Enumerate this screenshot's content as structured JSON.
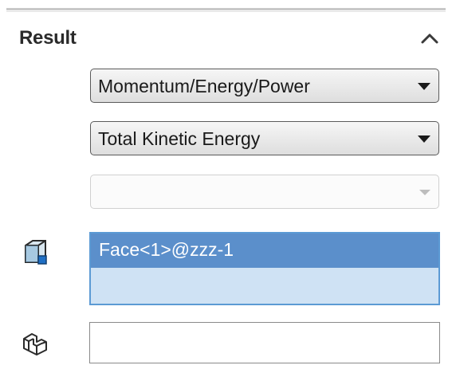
{
  "result_section": {
    "title": "Result",
    "collapse_icon": "chevron-up-icon"
  },
  "dropdowns": {
    "category": {
      "value": "Momentum/Energy/Power"
    },
    "component": {
      "value": "Total Kinetic Energy"
    },
    "sub_component": {
      "value": "",
      "state": "disabled"
    }
  },
  "face_selection": {
    "icon": "face-selection-icon",
    "items": [
      "Face<1>@zzz-1"
    ],
    "selected_index": 0
  },
  "component_selection": {
    "icon": "component-part-icon",
    "value": ""
  },
  "colors": {
    "selection_highlight": "#5b8fcb",
    "list_background": "#cfe2f4",
    "list_border": "#5c9ad4"
  }
}
